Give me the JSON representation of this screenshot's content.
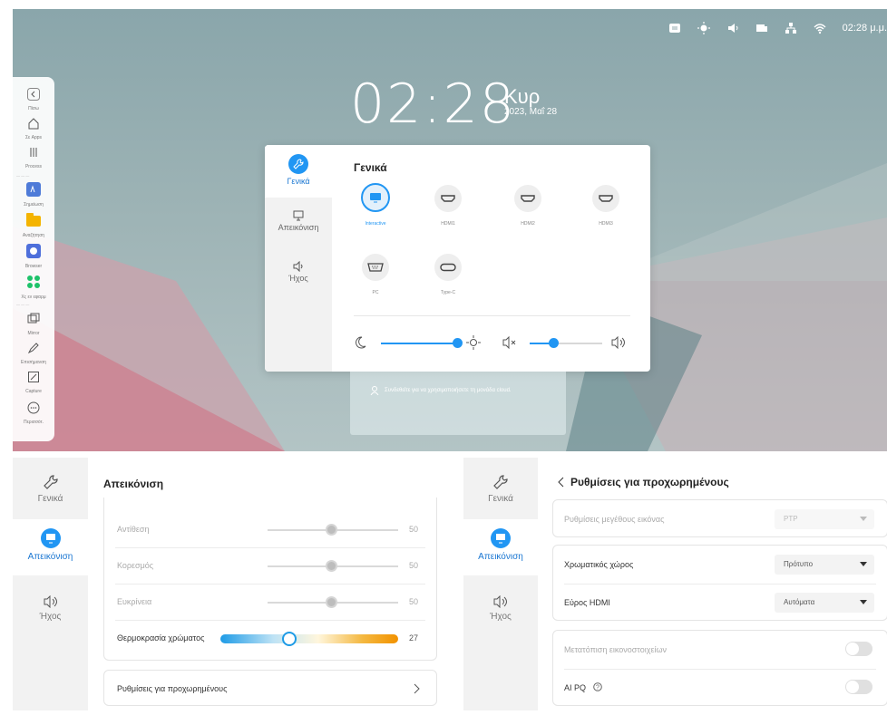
{
  "desktop": {
    "status": {
      "time": "02:28 μ.μ."
    },
    "clock": {
      "time": "02:28",
      "day": "Κυρ",
      "date": "2023, Μαΐ 28"
    },
    "dock": {
      "items": [
        {
          "name": "back",
          "label": "Πίσω"
        },
        {
          "name": "home",
          "label": "Σε Apps"
        },
        {
          "name": "process",
          "label": "Process"
        },
        {
          "name": "notes",
          "label": "Σημείωση"
        },
        {
          "name": "finder",
          "label": "Αναζήτηση"
        },
        {
          "name": "browser",
          "label": "Browser"
        },
        {
          "name": "apps",
          "label": "Χς εν εφαρμ"
        },
        {
          "name": "mirror",
          "label": "Mirror"
        },
        {
          "name": "annotate",
          "label": "Επισήμανση"
        },
        {
          "name": "capture",
          "label": "Capture"
        },
        {
          "name": "more",
          "label": "Περισσότ."
        }
      ]
    },
    "quick_settings": {
      "title": "Γενικά",
      "tabs": [
        {
          "label": "Γενικά"
        },
        {
          "label": "Απεικόνιση"
        },
        {
          "label": "Ήχος"
        }
      ],
      "sources": [
        {
          "label": "Interactive",
          "active": true
        },
        {
          "label": "HDMI1"
        },
        {
          "label": "HDMI2"
        },
        {
          "label": "HDMI3"
        },
        {
          "label": "PC"
        },
        {
          "label": "Type-C"
        }
      ],
      "brightness_fraction": 0.96,
      "volume_fraction": 0.32
    },
    "cloud_hint": "Συνδεθείτε για να χρησιμοποιήσετε τη μονάδα cloud."
  },
  "left_panel": {
    "tabs": [
      {
        "label": "Γενικά"
      },
      {
        "label": "Απεικόνιση"
      },
      {
        "label": "Ήχος"
      }
    ],
    "title": "Απεικόνιση",
    "rows": [
      {
        "label": "Αντίθεση",
        "value": "50"
      },
      {
        "label": "Κορεσμός",
        "value": "50"
      },
      {
        "label": "Ευκρίνεια",
        "value": "50"
      }
    ],
    "color_temp": {
      "label": "Θερμοκρασία χρώματος",
      "value": "27"
    },
    "advanced_link": "Ρυθμίσεις για προχωρημένους"
  },
  "right_panel": {
    "tabs": [
      {
        "label": "Γενικά"
      },
      {
        "label": "Απεικόνιση"
      },
      {
        "label": "Ήχος"
      }
    ],
    "title": "Ρυθμίσεις για προχωρημένους",
    "picture_size": {
      "label": "Ρυθμίσεις μεγέθους εικόνας",
      "value": "PTP"
    },
    "color_space": {
      "label": "Χρωματικός χώρος",
      "value": "Πρότυπο"
    },
    "hdmi_range": {
      "label": "Εύρος HDMI",
      "value": "Αυτόματα"
    },
    "pixel_shift": {
      "label": "Μετατόπιση εικονοστοιχείων"
    },
    "ai_pq": {
      "label": "AI PQ"
    }
  }
}
